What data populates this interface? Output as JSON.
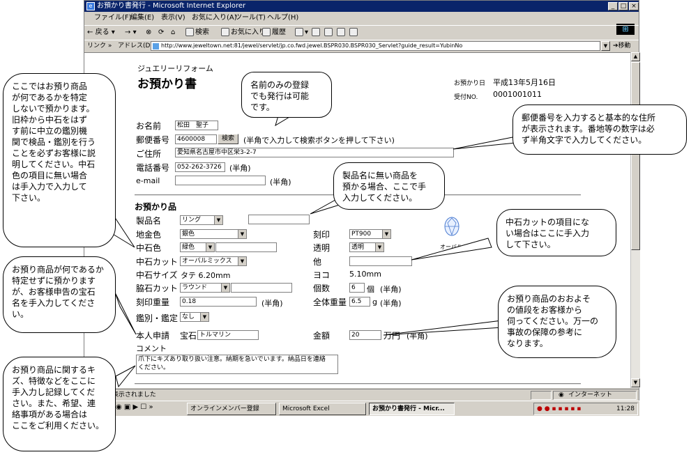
{
  "window": {
    "title": "お預かり書発行 - Microsoft Internet Explorer",
    "min": "_",
    "max": "□",
    "close": "×"
  },
  "menu": [
    "ファイル(F)",
    "編集(E)",
    "表示(V)",
    "お気に入り(A)",
    "ツール(T)",
    "ヘルプ(H)"
  ],
  "toolbar": {
    "back": "戻る",
    "forward": "→",
    "stop": "⊗",
    "refresh": "⟳",
    "home": "⌂",
    "search": "検索",
    "favorites": "お気に入り",
    "history": "履歴"
  },
  "address": {
    "links_label": "リンク »",
    "label": "アドレス(D)",
    "url": "http://www.jeweltown.net:81/jewel/servlet/jp.co.fwd.jewel.BSPR030.BSPR030_Servlet?guide_result=YubinNo",
    "go": "移動"
  },
  "page": {
    "company": "ジュエリーリフォーム",
    "heading": "お預かり書",
    "receipt_date_label": "お預かり日",
    "receipt_date": "平成13年5月16日",
    "receipt_no_label": "受付NO.",
    "receipt_no": "0001001011",
    "name_label": "お名前",
    "name": "松田　聖子",
    "zip_label": "郵便番号",
    "zip": "4600008",
    "zip_search_btn": "検索",
    "zip_hint": "(半角で入力して検索ボタンを押して下さい)",
    "address_label": "ご住所",
    "address": "愛知県名古屋市中区栄3-2-7",
    "phone_label": "電話番号",
    "phone": "052-262-3726",
    "phone_hint": "(半角)",
    "email_label": "e-mail",
    "email": "",
    "email_hint": "(半角)",
    "items_heading": "お預かり品",
    "product_label": "製品名",
    "product": "リング",
    "product_free": "",
    "metal_label": "地金色",
    "metal": "銀色",
    "stamp_label": "刻印",
    "stamp": "PT900",
    "stone_color_label": "中石色",
    "stone_color": "緑色",
    "stone_color_free": "",
    "clarity_label": "透明",
    "clarity": "透明",
    "cut_label": "中石カット",
    "cut": "オーバルミックス",
    "other_label": "他",
    "other": "",
    "size_label": "中石サイズ",
    "size_tate": "タテ 6.20mm",
    "size_yoko_label": "ヨコ",
    "size_yoko": "5.10mm",
    "side_cut_label": "脇石カット",
    "side_cut": "ラウンド",
    "side_cut_free": "",
    "count_label": "個数",
    "count": "6",
    "count_unit": "個",
    "count_hint": "(半角)",
    "stamp_weight_label": "刻印重量",
    "stamp_weight": "0.18",
    "stamp_weight_hint": "(半角)",
    "total_weight_label": "全体重量",
    "total_weight": "6.5",
    "total_weight_unit": "g",
    "total_weight_hint": "(半角)",
    "appraisal_label": "鑑別・鑑定",
    "appraisal": "なし",
    "declared_label": "本人申請",
    "declared_stone_label": "宝石",
    "declared_stone": "トルマリン",
    "amount_label": "金額",
    "amount": "20",
    "amount_unit": "万円",
    "amount_hint": "(半角)",
    "comment_label": "コメント",
    "comment": "爪下にキズあり取り扱い注意。納期を急いでいます。納品日を連絡ください。",
    "oval_label": "オーバル"
  },
  "status": {
    "text": "ページが表示されました",
    "zone": "インターネット"
  },
  "taskbar": {
    "tasks": [
      "オンラインメンバー登録",
      "Microsoft Excel",
      "お預かり書発行 - Micr..."
    ],
    "clock": "11:28"
  },
  "callouts": {
    "c1": "ここではお預り商品\nが何であるかを特定\nしないで預かります。\n旧枠から中石をはず\nす前に中立の鑑別機\n関で検品・鑑別を行う\nことを必ずお客様に説\n明してください。中石\n色の項目に無い場合\nは手入力で入力して\n下さい。",
    "c2": "名前のみの登録\nでも発行は可能\nです。",
    "c3": "郵便番号を入力すると基本的な住所\nが表示されます。番地等の数字は必\nず半角文字で入力してください。",
    "c4": "製品名に無い商品を\n預かる場合、ここで手\n入力してください。",
    "c5": "中石カットの項目にな\nい場合はここに手入力\nして下さい。",
    "c6": "お預り商品が何であるか\n特定せずに預かります\nが、お客様申告の宝石\n名を手入力してくださ\nい。",
    "c7": "お預り商品のおおよそ\nの値段をお客様から\n伺ってください。万一の\n事故の保障の参考に\nなります。",
    "c8": "お預り商品に関するキ\nズ、特徴などをここに\n手入力し記録してくだ\nさい。また、希望、連\n絡事項がある場合は\nここをご利用ください。"
  }
}
